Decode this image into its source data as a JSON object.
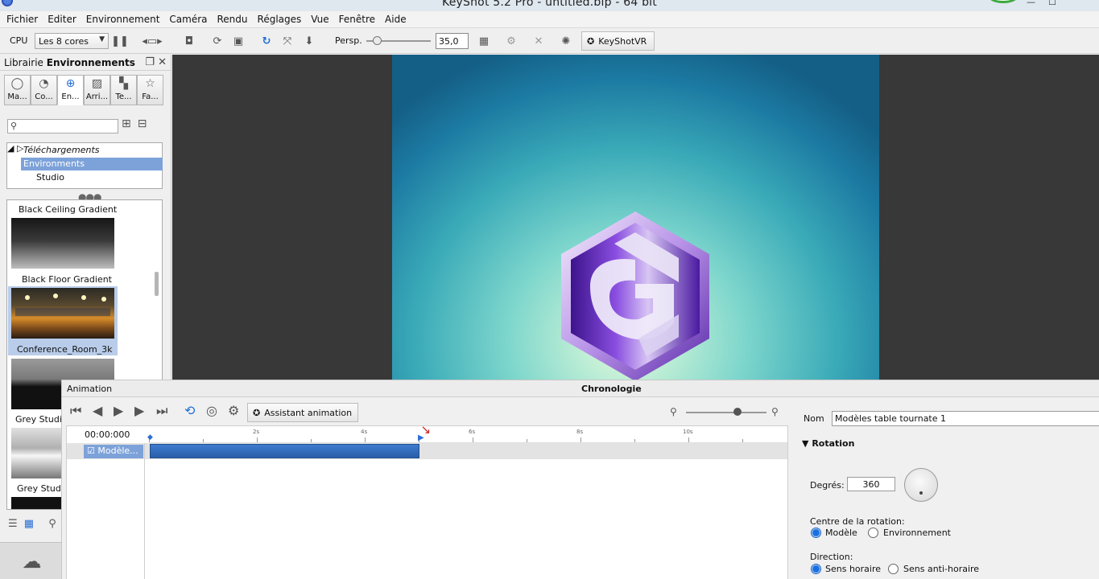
{
  "window": {
    "title": "KeyShot 5.2 Pro  - untitled.bip  - 64 bit",
    "minimize": "—",
    "maximize": "☐"
  },
  "menu": [
    "Fichier",
    "Editer",
    "Environnement",
    "Caméra",
    "Rendu",
    "Réglages",
    "Vue",
    "Fenêtre",
    "Aide"
  ],
  "toolbar": {
    "cpu_label": "CPU",
    "cpu_value": "Les 8 cores",
    "persp_label": "Persp.",
    "persp_value": "35,0",
    "vr_label": "KeyShotVR"
  },
  "library": {
    "tab_label": "Librairie",
    "active_label": "Environnements",
    "categories": [
      "Ma...",
      "Co...",
      "En...",
      "Arri...",
      "Te...",
      "Fa..."
    ],
    "search_placeholder": "",
    "tree": {
      "downloads": "Téléchargements",
      "environments": "Environments",
      "studio": "Studio"
    },
    "thumbnails": [
      "Black Ceiling Gradient",
      "Black Floor Gradient",
      "Conference_Room_3k",
      "Grey Studio",
      "Grey Studio"
    ]
  },
  "animation": {
    "panel_label": "Animation",
    "chrono_label": "Chronologie",
    "assistant_label": "Assistant animation",
    "time": "00:00:000",
    "ruler_labels": [
      "2s",
      "4s",
      "6s",
      "8s",
      "10s"
    ],
    "track_name": "Modèle..."
  },
  "properties": {
    "name_label": "Nom",
    "name_value": "Modèles table tournate 1",
    "rotation_label": "Rotation",
    "degrees_label": "Degrés:",
    "degrees_value": "360",
    "center_label": "Centre de la rotation:",
    "center_model": "Modèle",
    "center_env": "Environnement",
    "direction_label": "Direction:",
    "dir_cw": "Sens horaire",
    "dir_ccw": "Sens anti-horaire"
  }
}
